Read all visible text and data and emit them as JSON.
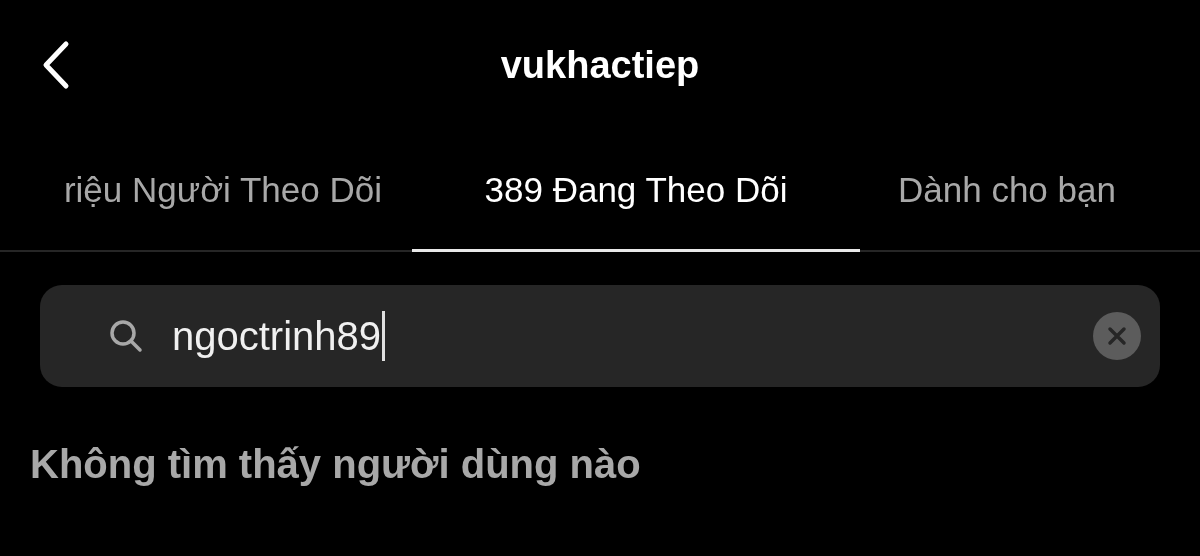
{
  "header": {
    "title": "vukhactiep"
  },
  "tabs": [
    {
      "label": "riệu Người Theo Dõi",
      "selected": false
    },
    {
      "label": "389 Đang Theo Dõi",
      "selected": true
    },
    {
      "label": "Dành cho bạn",
      "selected": false
    }
  ],
  "search": {
    "value": "ngoctrinh89"
  },
  "message": "Không tìm thấy người dùng nào"
}
